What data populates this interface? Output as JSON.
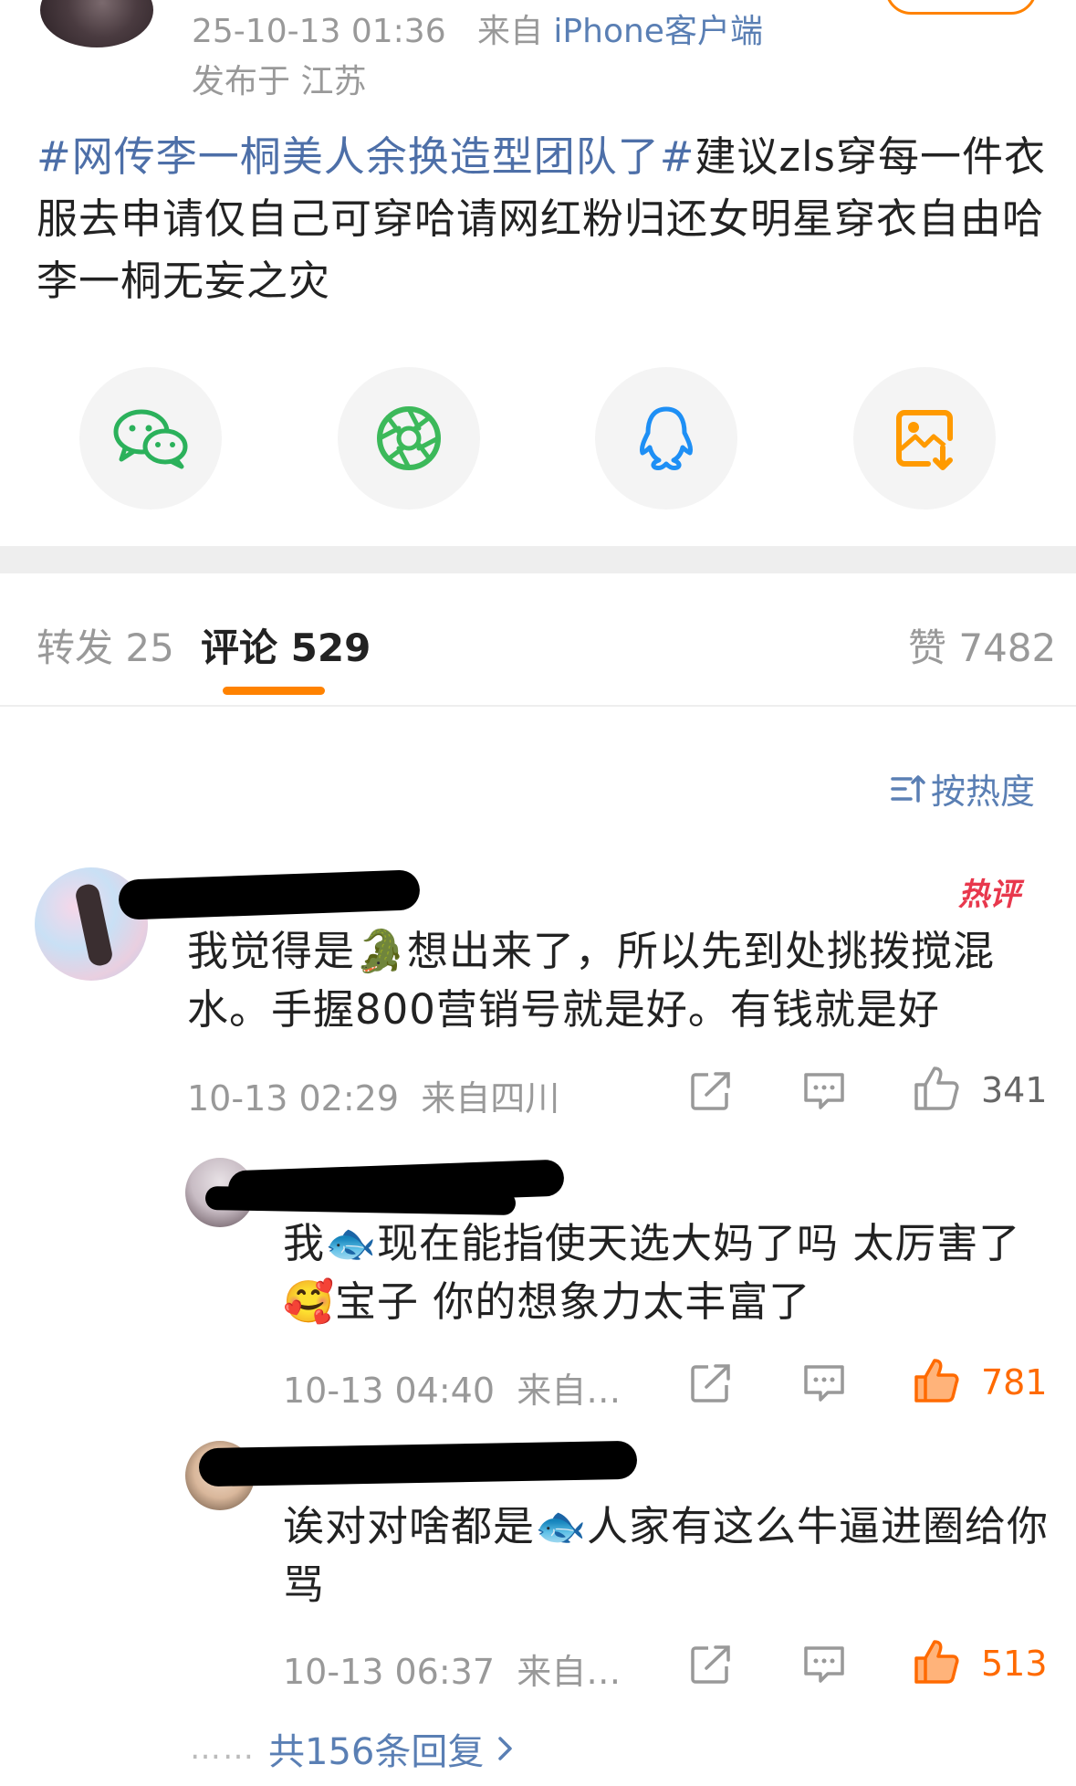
{
  "post": {
    "timestamp": "25-10-13 01:36",
    "source_prefix": "来自",
    "source": "iPhone客户端",
    "location": "发布于 江苏",
    "topic1": "#网传李一桐美人余换造型团队了#",
    "body": "建议zls穿每一件衣服去申请仅自己可穿哈请网红粉归还女明星穿衣自由哈 李一桐无妄之灾"
  },
  "share": {
    "items": [
      {
        "icon": "wechat-icon",
        "color": "#2bb15b"
      },
      {
        "icon": "moments-icon",
        "color": "#3cb95a"
      },
      {
        "icon": "qq-icon",
        "color": "#1e8ff5"
      },
      {
        "icon": "save-image-icon",
        "color": "#ff9a00"
      }
    ]
  },
  "tabs": {
    "repost": "转发 25",
    "comments": "评论 529",
    "likes": "赞 7482"
  },
  "sort": {
    "label": "按热度"
  },
  "comments": [
    {
      "text": "我觉得是🐊想出来了，所以先到处挑拨搅混水。手握800营销号就是好。有钱就是好",
      "time": "10-13 02:29",
      "from": "来自四川",
      "likes": "341",
      "badge": "热评"
    },
    {
      "text": "我🐟现在能指使天选大妈了吗 太厉害了🥰宝子 你的想象力太丰富了",
      "time": "10-13 04:40",
      "from": "来自…",
      "likes": "781"
    },
    {
      "text": "诶对对啥都是🐟人家有这么牛逼进圈给你骂",
      "time": "10-13 06:37",
      "from": "来自…",
      "likes": "513"
    }
  ],
  "replies": {
    "dots": "……",
    "label": "共156条回复"
  },
  "colors": {
    "accent": "#ff8200",
    "link": "#5a7fb4",
    "hot": "#ff6a00"
  }
}
